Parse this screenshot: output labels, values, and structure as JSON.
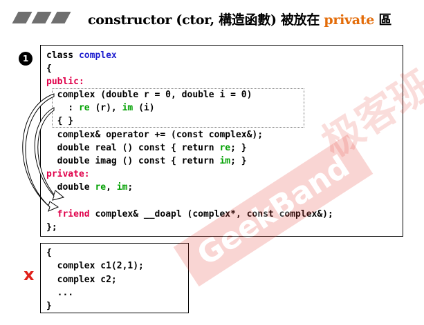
{
  "header": {
    "title_prefix": "constructor (ctor, 構造函數) 被放在 ",
    "title_highlight": "private",
    "title_suffix": " 區"
  },
  "badge": "1",
  "class_code": {
    "l1_kw": "class",
    "l1_name": "complex",
    "l2": "{",
    "l3": "public:",
    "l4": "  complex (double r = 0, double i = 0)",
    "l5_a": "    : ",
    "l5_re": "re",
    "l5_b": " (r), ",
    "l5_im": "im",
    "l5_c": " (i)",
    "l6": "  { }",
    "l7": "  complex& operator += (const complex&);",
    "l8_a": "  double real () const { return ",
    "l8_re": "re",
    "l8_b": "; }",
    "l9_a": "  double imag () const { return ",
    "l9_im": "im",
    "l9_b": "; }",
    "l10": "private:",
    "l11_a": "  double ",
    "l11_re": "re",
    "l11_b": ", ",
    "l11_im": "im",
    "l11_c": ";",
    "l12_kw": "  friend",
    "l12_rest": " complex& __doapl (complex*, const complex&);",
    "l13": "};"
  },
  "usage_code": {
    "l1": "{",
    "l2": "  complex c1(2,1);",
    "l3": "  complex c2;",
    "l4": "  ...",
    "l5": "}"
  },
  "x_mark": "x",
  "watermark": {
    "brand": "GeekBand",
    "cjk": "极客班"
  },
  "colors": {
    "keyword": "#1f1fcf",
    "access": "#e0004a",
    "member": "#00a000",
    "highlight": "#e36c09",
    "error": "#e0201a"
  }
}
